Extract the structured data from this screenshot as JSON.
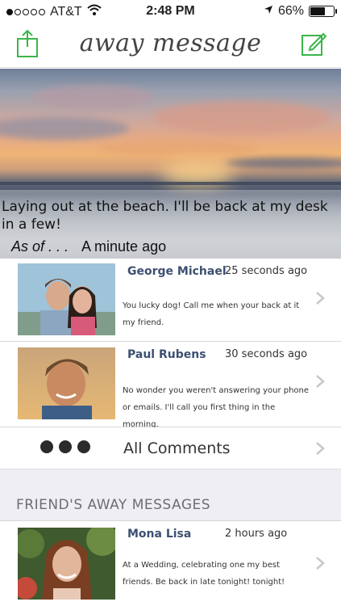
{
  "status_bar": {
    "carrier": "AT&T",
    "time": "2:48 PM",
    "battery_percent": "66%",
    "battery_level": 0.66,
    "signal_dots_filled": 1,
    "signal_dots_total": 5,
    "icons": [
      "wifi-icon",
      "location-arrow-icon",
      "battery-icon"
    ]
  },
  "nav": {
    "title": "away message",
    "left_icon": "share-icon",
    "right_icon": "compose-icon",
    "accent_color": "#3bb54a"
  },
  "hero": {
    "message": "Laying out at the beach. I'll be back at my desk in a few!",
    "as_of_label": "As of . . .",
    "as_of_value": "A minute ago"
  },
  "comments": [
    {
      "name": "George Michael",
      "time": "25 seconds ago",
      "text": "You lucky dog!  Call me when your back at it my friend."
    },
    {
      "name": "Paul Rubens",
      "time": "30 seconds ago",
      "text": "No wonder you weren't answering your phone or emails.  I'll call you first thing in the morning."
    }
  ],
  "all_comments_label": "All Comments",
  "friends_section": {
    "title": "FRIEND'S AWAY MESSAGES",
    "items": [
      {
        "name": "Mona Lisa",
        "time": "2 hours ago",
        "text": "At a Wedding, celebrating one my best friends. Be back in late tonight! tonight!"
      }
    ]
  }
}
